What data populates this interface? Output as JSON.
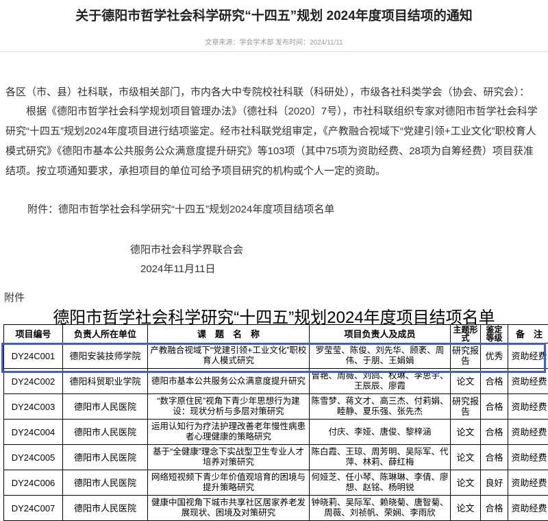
{
  "article": {
    "title": "关于德阳市哲学社会科学研究“十四五”规划 2024年度项目结项的通知",
    "meta": "文章来源：学会学术部 发布时间：2024/11/11",
    "para1": "各区（市、县）社科联，市级相关部门，市内各大中专院校社科联（科研处），市级各社科类学会（协会、研究会）：",
    "para2": "根据《德阳市哲学社会科学规划项目管理办法》（德社科〔2020〕7号），市社科联组织专家对德阳市哲学社会科学研究“十四五”规划2024年度项目进行结项鉴定。经市社科联党组审定，《产教融合视域下“党建引领+工业文化”职校育人模式研究》《德阳市基本公共服务公众满意度提升研究》等103项（其中75项为资助经费、28项为自筹经费）项目获准结项。按立项通知要求，承担项目的单位可给予项目研究的机构或个人一定的资助。",
    "attachment_line": "附件：德阳市哲学社会科学研究“十四五”规划2024年度项目结项名单",
    "signature": "德阳市社会科学界联合会",
    "date": "2024年11月11日",
    "attach_label": "附件",
    "table_title": "德阳市哲学社会科学研究“十四五”规划2024年度项目结项名单"
  },
  "table": {
    "headers": [
      "项目编号",
      "负责人所在单位",
      "课　题　名　称",
      "项目负责人及成员",
      "主题形式",
      "鉴定等级",
      "备　注"
    ],
    "rows": [
      {
        "id": "DY24C001",
        "unit": "德阳安装技师学院",
        "name": "产教融合视域下“党建引领+工业文化”职校育人模式研究",
        "members": "罗莹莹、陈俊、刘先华、顾袤、周伟、于朋、王娟娟",
        "form": "研究报告",
        "grade": "优秀",
        "note": "资助经费"
      },
      {
        "id": "DY24C002",
        "unit": "德阳科贸职业学院",
        "name": "德阳市基本公共服务公众满意度提升研究",
        "members": "曾艳、周薇、刘鸽、权琳、李思宇、王辰辰、廖霞",
        "form": "论文",
        "grade": "合格",
        "note": "资助经费"
      },
      {
        "id": "DY24C003",
        "unit": "德阳市人民医院",
        "name": "“数字原住民”视角下青少年思想行为建设：现状分析与多层对策研究",
        "members": "陈雪梦、蒋文才、高三杰、付莉娟、睦静、夏乐强、张先杰",
        "form": "研究报告",
        "grade": "合格",
        "note": "资助经费"
      },
      {
        "id": "DY24C004",
        "unit": "德阳市人民医院",
        "name": "运用认知行为疗法护理改善老年慢性病患者心理健康的策略研究",
        "members": "付庆、李娅、唐俊、黎梓涵",
        "form": "论文",
        "grade": "合格",
        "note": "资助经费"
      },
      {
        "id": "DY24C005",
        "unit": "德阳市人民医院",
        "name": "基于“全健康”理念下实战型卫生专业人才培养对策研究",
        "members": "陈白霞、王琼、周芳明、吴际军、代萍、林莉、薛红梅",
        "form": "论文",
        "grade": "合格",
        "note": "资助经费"
      },
      {
        "id": "DY24C006",
        "unit": "德阳市人民医院",
        "name": "网络短视频下青少年价值观培育的困境与提升策略研究",
        "members": "何娅芝、任小琴、陈琳琳、李倩、廖想、赵铭、杨明锐",
        "form": "论文",
        "grade": "良好",
        "note": "资助经费"
      },
      {
        "id": "DY24C007",
        "unit": "德阳市人民医院",
        "name": "健康中国视角下城市共享社区居家养老发展现状、困境及对策研究",
        "members": "钟晓莉、吴际军、赖晓菊、唐智菊、周薇、刘祯帆、荣娴、李雨欣",
        "form": "论文",
        "grade": "合格",
        "note": "资助经费"
      }
    ]
  },
  "colors": {
    "highlight": "#3f5fc8"
  }
}
